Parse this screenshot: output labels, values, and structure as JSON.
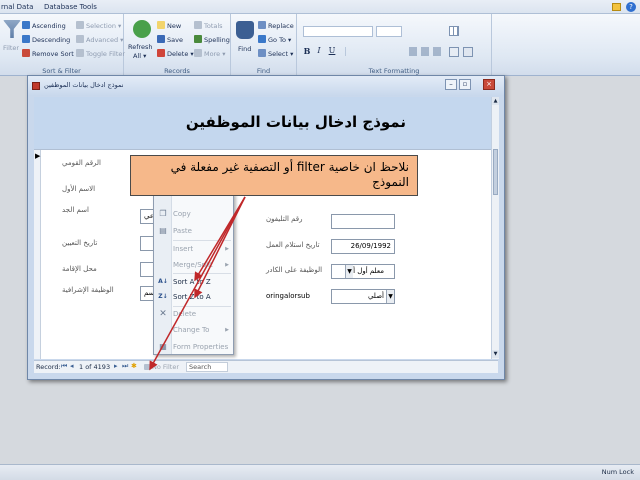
{
  "ribbon": {
    "tabs": [
      "rnal Data",
      "Database Tools"
    ],
    "sort_filter": {
      "group_label": "Sort & Filter",
      "filter": "Filter",
      "ascending": "Ascending",
      "descending": "Descending",
      "remove_sort": "Remove Sort",
      "selection": "Selection",
      "advanced": "Advanced",
      "toggle_filter": "Toggle Filter"
    },
    "records": {
      "group_label": "Records",
      "refresh": "Refresh",
      "refresh_all": "All",
      "new": "New",
      "save": "Save",
      "delete": "Delete",
      "totals": "Totals",
      "spelling": "Spelling",
      "more": "More"
    },
    "find": {
      "group_label": "Find",
      "find": "Find",
      "replace": "Replace",
      "go_to": "Go To",
      "select": "Select"
    },
    "text_formatting": {
      "group_label": "Text Formatting",
      "bold": "B",
      "italic": "I",
      "underline": "U"
    }
  },
  "form": {
    "window_title": "نموذج ادخال بيانات الموظفين",
    "header_title": "نموذج ادخال بيانات الموظفين",
    "fields": {
      "national_id_label": "الرقم القومي",
      "first_name_label": "الاسم الأول",
      "grandfather_label": "اسم الجد",
      "hire_date_label": "تاريخ التعيين",
      "residence_label": "محل الإقامة",
      "supervisory_label": "الوظيفة الإشرافية",
      "phone_label": "رقم التليفون",
      "work_start_label": "تاريخ استلام العمل",
      "cadre_label": "الوظيفة على الكادر",
      "orig_sub_label": "oringalorsub",
      "work_start_value": "26/09/1992",
      "cadre_value": "معلم أول أ",
      "orig_sub_value": "أصلي",
      "partial_1": "عي",
      "partial_2": "قسم"
    },
    "nav": {
      "record_label": "Record:",
      "record_position": "1 of 4193",
      "no_filter": "No Filter",
      "search": "Search"
    }
  },
  "context_menu": [
    {
      "label": "Copy",
      "enabled": false
    },
    {
      "label": "Paste",
      "enabled": false
    },
    {
      "label": "Insert",
      "enabled": false
    },
    {
      "label": "Merge/Split",
      "enabled": false
    },
    {
      "label": "Sort A to Z",
      "enabled": true
    },
    {
      "label": "Sort Z to A",
      "enabled": true
    },
    {
      "label": "Delete",
      "enabled": false
    },
    {
      "label": "Change To",
      "enabled": false
    },
    {
      "label": "Form Properties",
      "enabled": false
    }
  ],
  "callout": {
    "text": "نلاحظ ان خاصية filter أو التصفية غير مفعلة في النموذج"
  },
  "status": {
    "num_lock": "Num Lock"
  },
  "colors": {
    "callout_fill": "#f6b88a",
    "arrow": "#c0282a",
    "form_header": "#c4d7ee"
  }
}
